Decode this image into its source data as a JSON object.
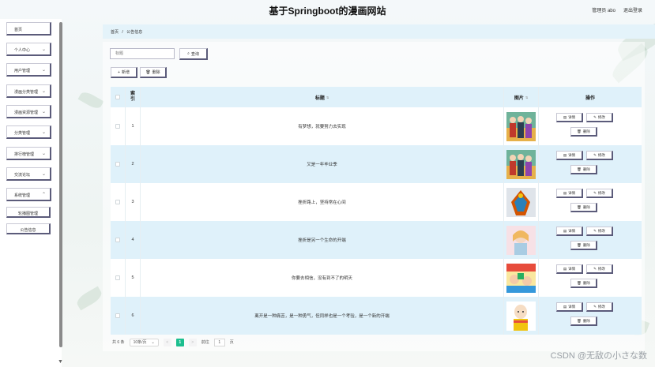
{
  "header": {
    "title": "基于Springboot的漫画网站",
    "user_label": "管理员 abo",
    "logout_label": "退出登录"
  },
  "sidebar": {
    "items": [
      {
        "label": "首页",
        "has_children": false
      },
      {
        "label": "个人中心",
        "has_children": true
      },
      {
        "label": "用户管理",
        "has_children": true
      },
      {
        "label": "漫画分类管理",
        "has_children": true
      },
      {
        "label": "漫画资源管理",
        "has_children": true
      },
      {
        "label": "分类管理",
        "has_children": true
      },
      {
        "label": "排行榜管理",
        "has_children": true
      },
      {
        "label": "交流论坛",
        "has_children": true
      },
      {
        "label": "系统管理",
        "has_children": true
      }
    ],
    "sub_items": [
      {
        "label": "轮播图管理"
      },
      {
        "label": "公告信息"
      }
    ]
  },
  "breadcrumb": {
    "home": "首页",
    "separator": "/",
    "current": "公告信息"
  },
  "search": {
    "placeholder": "标题",
    "value": "",
    "button_label": "查询"
  },
  "toolbar": {
    "add_label": "新增",
    "delete_label": "删除"
  },
  "table": {
    "columns": {
      "index": "索引",
      "title": "标题",
      "image": "图片",
      "actions": "操作"
    },
    "rows": [
      {
        "index": "1",
        "title": "有梦想，就要努力去实现"
      },
      {
        "index": "2",
        "title": "又是一年毕业季"
      },
      {
        "index": "3",
        "title": "挫折路上，坚持常在心间"
      },
      {
        "index": "4",
        "title": "挫折是另一个生命的开端"
      },
      {
        "index": "5",
        "title": "你要去相信，没有到不了的明天"
      },
      {
        "index": "6",
        "title": "离开是一种痛苦，是一种勇气，但同样也是一个考验，是一个新的开端"
      }
    ],
    "action_labels": {
      "detail": "详情",
      "edit": "修改",
      "delete": "删除"
    }
  },
  "pagination": {
    "total_text": "共 6 条",
    "page_size": "10条/页",
    "prev_symbol": "<",
    "current_page": "1",
    "next_symbol": ">",
    "goto_label": "前往",
    "goto_value": "1",
    "page_suffix": "页"
  },
  "watermark": "CSDN @无敌の小さな数",
  "colors": {
    "accent": "#1dbf8f",
    "row_highlight": "#dff1fa",
    "button_border": "#5b5b7a"
  }
}
